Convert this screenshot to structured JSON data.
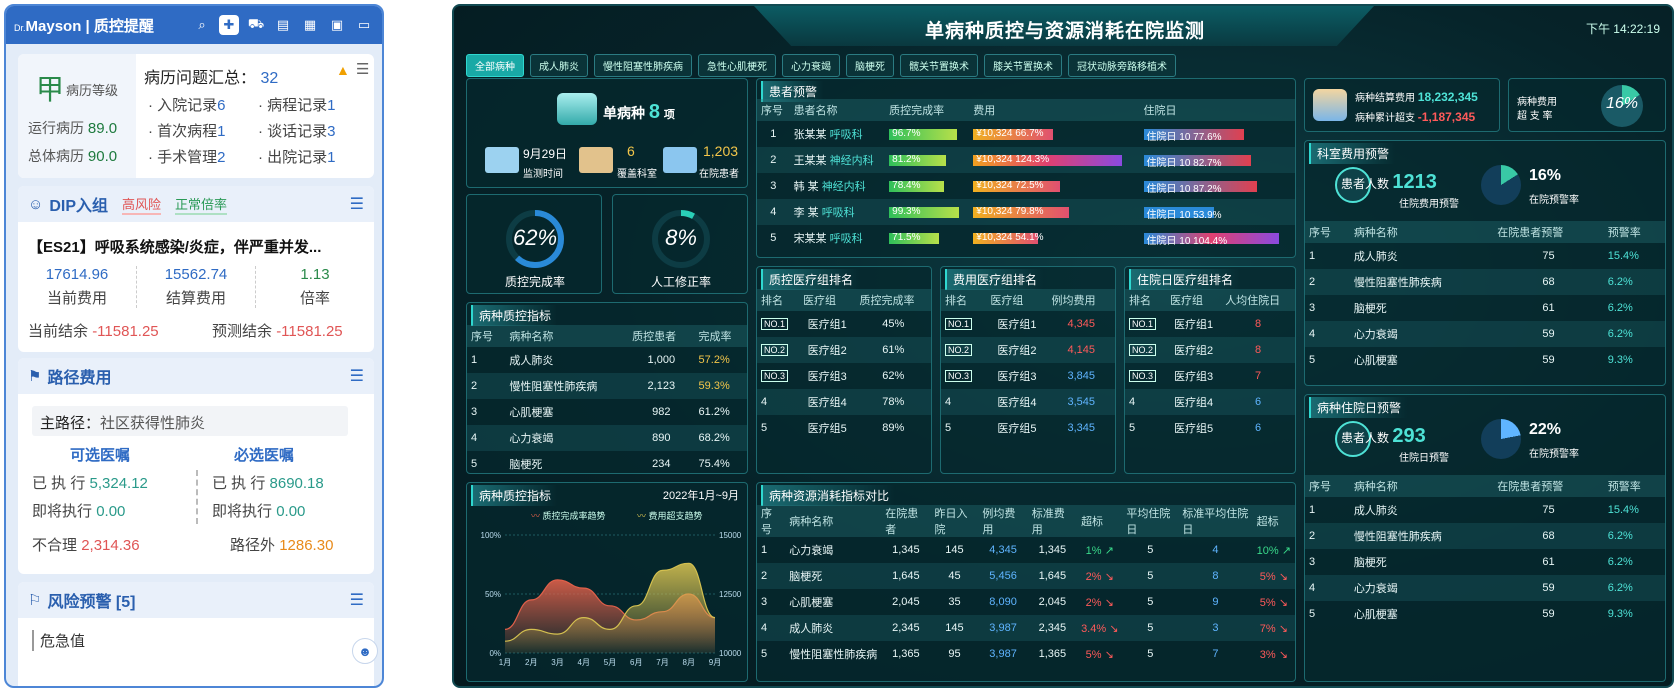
{
  "left": {
    "brand_small": "Dr.",
    "brand": "Mayson",
    "app_title": "质控提醒",
    "card1": {
      "grade": "甲",
      "grade_label": "病历等级",
      "running_label": "运行病历",
      "running_value": "89.0",
      "total_label": "总体病历",
      "total_value": "90.0",
      "summary_label": "病历问题汇总：",
      "summary_value": "32",
      "items": [
        {
          "label": "入院记录",
          "value": "6"
        },
        {
          "label": "病程记录",
          "value": "1"
        },
        {
          "label": "首次病程",
          "value": "1"
        },
        {
          "label": "谈话记录",
          "value": "3"
        },
        {
          "label": "手术管理",
          "value": "2"
        },
        {
          "label": "出院记录",
          "value": "1"
        }
      ]
    },
    "dip": {
      "title": "DIP入组",
      "tag_high": "高风险",
      "tag_normal": "正常倍率",
      "group": "【ES21】呼吸系统感染/炎症，伴严重并发...",
      "current_fee": "17614.96",
      "current_fee_label": "当前费用",
      "settle_fee": "15562.74",
      "settle_fee_label": "结算费用",
      "ratio": "1.13",
      "ratio_label": "倍率",
      "cur_bal_label": "当前结余",
      "cur_bal": "-11581.25",
      "pred_bal_label": "预测结余",
      "pred_bal": "-11581.25"
    },
    "path": {
      "title": "路径费用",
      "main_label": "主路径：",
      "main_value": "社区获得性肺炎",
      "optional": "可选医嘱",
      "required": "必选医嘱",
      "executed_label": "已 执 行",
      "executed_opt": "5,324.12",
      "executed_req": "8690.18",
      "pending_label": "即将执行",
      "pending_opt": "0.00",
      "pending_req": "0.00",
      "unreasonable_label": "不合理",
      "unreasonable": "2,314.36",
      "outside_label": "路径外",
      "outside": "1286.30"
    },
    "risk": {
      "title": "风险预警 [5]",
      "first": "危急值"
    }
  },
  "dash": {
    "title": "单病种质控与资源消耗在院监测",
    "time": "下午 14:22:19",
    "tabs": [
      "全部病种",
      "成人肺炎",
      "慢性阻塞性肺疾病",
      "急性心肌梗死",
      "心力衰竭",
      "脑梗死",
      "髋关节置换术",
      "膝关节置换术",
      "冠状动脉旁路移植术"
    ],
    "overview": {
      "label": "单病种",
      "count": "8",
      "unit": "项",
      "date": "9月29日",
      "date_label": "监测时间",
      "depts": "6",
      "depts_label": "覆盖科室",
      "patients": "1,203",
      "patients_label": "在院患者"
    },
    "qc_rate": {
      "value": "62%",
      "label": "质控完成率",
      "pct": 62
    },
    "manual_rate": {
      "value": "8%",
      "label": "人工修正率",
      "pct": 8
    },
    "disease_idx": {
      "title": "病种质控指标",
      "headers": [
        "序号",
        "病种名称",
        "质控患者",
        "完成率"
      ],
      "rows": [
        [
          "1",
          "成人肺炎",
          "1,000",
          "57.2%"
        ],
        [
          "2",
          "慢性阻塞性肺疾病",
          "2,123",
          "59.3%"
        ],
        [
          "3",
          "心肌梗塞",
          "982",
          "61.2%"
        ],
        [
          "4",
          "心力衰竭",
          "890",
          "68.2%"
        ],
        [
          "5",
          "脑梗死",
          "234",
          "75.4%"
        ]
      ]
    },
    "trend": {
      "title": "病种质控指标",
      "range": "2022年1月~9月",
      "legend1": "质控完成率趋势",
      "legend2": "费用超支趋势"
    },
    "patients": {
      "title": "患者预警",
      "headers": [
        "序号",
        "患者名称",
        "质控完成率",
        "费用",
        "住院日"
      ],
      "rows": [
        {
          "no": "1",
          "name": "张某某",
          "dept": "呼吸科",
          "qc": "96.7%",
          "qc_v": 96.7,
          "fee": "¥10,324",
          "fee_pct": "66.7%",
          "fee_v": 66.7,
          "day": "住院日 10",
          "day_pct": "77.6%",
          "day_v": 77.6
        },
        {
          "no": "2",
          "name": "王某某",
          "dept": "神经内科",
          "qc": "81.2%",
          "qc_v": 81.2,
          "fee": "¥10,324",
          "fee_pct": "124.3%",
          "fee_v": 124.3,
          "day": "住院日 10",
          "day_pct": "82.7%",
          "day_v": 82.7
        },
        {
          "no": "3",
          "name": "韩 某",
          "dept": "神经内科",
          "qc": "78.4%",
          "qc_v": 78.4,
          "fee": "¥10,324",
          "fee_pct": "72.5%",
          "fee_v": 72.5,
          "day": "住院日 10",
          "day_pct": "87.2%",
          "day_v": 87.2
        },
        {
          "no": "4",
          "name": "李 某",
          "dept": "呼吸科",
          "qc": "99.3%",
          "qc_v": 99.3,
          "fee": "¥10,324",
          "fee_pct": "79.8%",
          "fee_v": 79.8,
          "day": "住院日 10",
          "day_pct": "53.9%",
          "day_v": 53.9
        },
        {
          "no": "5",
          "name": "宋某某",
          "dept": "呼吸科",
          "qc": "71.5%",
          "qc_v": 71.5,
          "fee": "¥10,324",
          "fee_pct": "54.1%",
          "fee_v": 54.1,
          "day": "住院日 10",
          "day_pct": "104.4%",
          "day_v": 104.4
        }
      ]
    },
    "rank_qc": {
      "title": "质控医疗组排名",
      "headers": [
        "排名",
        "医疗组",
        "质控完成率"
      ],
      "rows": [
        [
          "NO.1",
          "医疗组1",
          "45%"
        ],
        [
          "NO.2",
          "医疗组2",
          "61%"
        ],
        [
          "NO.3",
          "医疗组3",
          "62%"
        ],
        [
          "4",
          "医疗组4",
          "78%"
        ],
        [
          "5",
          "医疗组5",
          "89%"
        ]
      ]
    },
    "rank_fee": {
      "title": "费用医疗组排名",
      "headers": [
        "排名",
        "医疗组",
        "例均费用"
      ],
      "rows": [
        [
          "NO.1",
          "医疗组1",
          "4,345"
        ],
        [
          "NO.2",
          "医疗组2",
          "4,145"
        ],
        [
          "NO.3",
          "医疗组3",
          "3,845"
        ],
        [
          "4",
          "医疗组4",
          "3,545"
        ],
        [
          "5",
          "医疗组5",
          "3,345"
        ]
      ]
    },
    "rank_day": {
      "title": "住院日医疗组排名",
      "headers": [
        "排名",
        "医疗组",
        "人均住院日"
      ],
      "rows": [
        [
          "NO.1",
          "医疗组1",
          "8"
        ],
        [
          "NO.2",
          "医疗组2",
          "8"
        ],
        [
          "NO.3",
          "医疗组3",
          "7"
        ],
        [
          "4",
          "医疗组4",
          "6"
        ],
        [
          "5",
          "医疗组5",
          "6"
        ]
      ]
    },
    "resource": {
      "title": "病种资源消耗指标对比",
      "headers": [
        "序号",
        "病种名称",
        "在院患者",
        "昨日入院",
        "例均费用",
        "标准费用",
        "超标",
        "平均住院日",
        "标准平均住院日",
        "超标"
      ],
      "rows": [
        [
          "1",
          "心力衰竭",
          "1,345",
          "145",
          "4,345",
          "1,345",
          "1% ↗",
          "5",
          "4",
          "10% ↗"
        ],
        [
          "2",
          "脑梗死",
          "1,645",
          "45",
          "5,456",
          "1,645",
          "2% ↘",
          "5",
          "8",
          "5% ↘"
        ],
        [
          "3",
          "心肌梗塞",
          "2,045",
          "35",
          "8,090",
          "2,045",
          "2% ↘",
          "5",
          "9",
          "5% ↘"
        ],
        [
          "4",
          "成人肺炎",
          "2,345",
          "145",
          "3,987",
          "2,345",
          "3.4% ↘",
          "5",
          "3",
          "7% ↘"
        ],
        [
          "5",
          "慢性阻塞性肺疾病",
          "1,365",
          "95",
          "3,987",
          "1,365",
          "5% ↘",
          "5",
          "7",
          "3% ↘"
        ]
      ]
    },
    "cost": {
      "settle_label": "病种结算费用",
      "settle": "18,232,345",
      "over_label": "病种累计超支",
      "over": "-1,187,345",
      "pay_label1": "病种费用",
      "pay_label2": "超 支 率",
      "pay_rate": "16%"
    },
    "dept_fee": {
      "title": "科室费用预警",
      "count_label": "患者人数",
      "count": "1213",
      "count_sub": "住院费用预警",
      "rate": "16%",
      "rate_sub": "在院预警率",
      "rate_pct": 16,
      "headers": [
        "序号",
        "病种名称",
        "在院患者预警",
        "预警率"
      ],
      "rows": [
        [
          "1",
          "成人肺炎",
          "75",
          "15.4%"
        ],
        [
          "2",
          "慢性阻塞性肺疾病",
          "68",
          "6.2%"
        ],
        [
          "3",
          "脑梗死",
          "61",
          "6.2%"
        ],
        [
          "4",
          "心力衰竭",
          "59",
          "6.2%"
        ],
        [
          "5",
          "心肌梗塞",
          "59",
          "9.3%"
        ]
      ]
    },
    "dept_day": {
      "title": "病种住院日预警",
      "count_label": "患者人数",
      "count": "293",
      "count_sub": "住院日预警",
      "rate": "22%",
      "rate_sub": "在院预警率",
      "rate_pct": 22,
      "headers": [
        "序号",
        "病种名称",
        "在院患者预警",
        "预警率"
      ],
      "rows": [
        [
          "1",
          "成人肺炎",
          "75",
          "15.4%"
        ],
        [
          "2",
          "慢性阻塞性肺疾病",
          "68",
          "6.2%"
        ],
        [
          "3",
          "脑梗死",
          "61",
          "6.2%"
        ],
        [
          "4",
          "心力衰竭",
          "59",
          "6.2%"
        ],
        [
          "5",
          "心肌梗塞",
          "59",
          "9.3%"
        ]
      ]
    }
  },
  "chart_data": {
    "type": "area",
    "title": "病种质控指标",
    "categories": [
      "1月",
      "2月",
      "3月",
      "4月",
      "5月",
      "6月",
      "7月",
      "8月",
      "9月"
    ],
    "series": [
      {
        "name": "质控完成率趋势",
        "axis": "left",
        "values": [
          20,
          45,
          62,
          55,
          40,
          28,
          35,
          50,
          30
        ]
      },
      {
        "name": "费用超支趋势",
        "axis": "right",
        "values": [
          10500,
          11000,
          10800,
          11500,
          11000,
          12000,
          13500,
          13800,
          11500
        ]
      }
    ],
    "ylim_left": [
      0,
      100
    ],
    "ylim_right": [
      10000,
      15000
    ],
    "yticks_left": [
      "0%",
      "50%",
      "100%"
    ],
    "yticks_right": [
      "10000",
      "12500",
      "15000"
    ],
    "legend": "top"
  }
}
